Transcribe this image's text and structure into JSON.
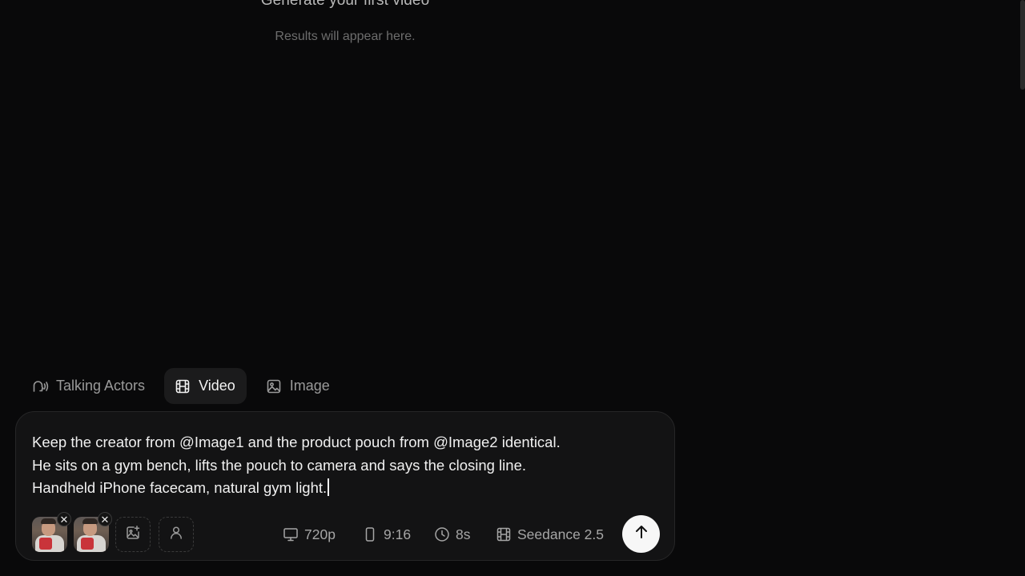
{
  "empty_state": {
    "title": "Generate your first video",
    "subtitle": "Results will appear here."
  },
  "mode_tabs": [
    {
      "label": "Talking Actors",
      "icon": "voice-person-icon",
      "active": false
    },
    {
      "label": "Video",
      "icon": "film-icon",
      "active": true
    },
    {
      "label": "Image",
      "icon": "image-icon",
      "active": false
    }
  ],
  "composer": {
    "prompt_lines": [
      "Keep the creator from @Image1 and the product pouch from @Image2 identical.",
      "He sits on a gym bench, lifts the pouch to camera and says the closing line.",
      "Handheld iPhone facecam, natural gym light."
    ],
    "attachments": [
      {
        "ref": "@Image1",
        "remove_label": "✕"
      },
      {
        "ref": "@Image2",
        "remove_label": "✕"
      }
    ],
    "add_image_icon": "add-image-icon",
    "actor_icon": "person-icon",
    "options": {
      "resolution": "720p",
      "aspect_ratio": "9:16",
      "duration": "8s",
      "model": "Seedance 2.5"
    },
    "send_icon": "arrow-up-icon"
  },
  "colors": {
    "background": "#09090a",
    "composer_bg": "#131314",
    "active_tab_bg": "#1b1b1c",
    "send_button": "#f7f7f7"
  }
}
